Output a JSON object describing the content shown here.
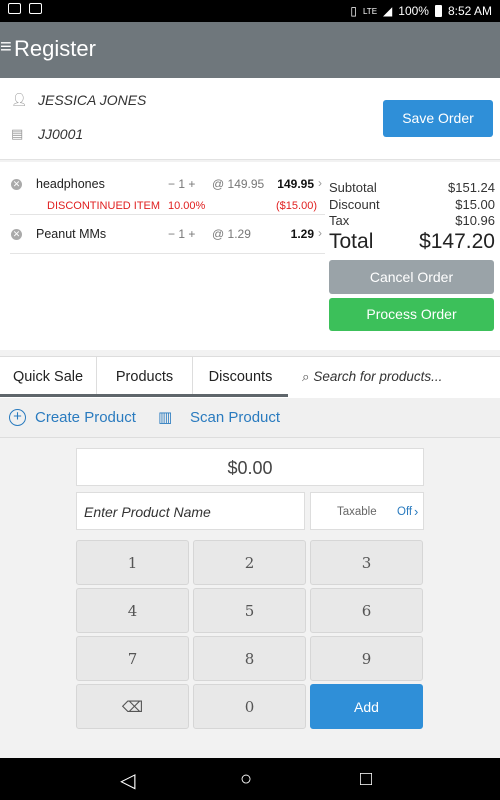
{
  "status_bar": {
    "lte": "LTE",
    "battery": "100%",
    "time": "8:52 AM"
  },
  "app_bar": {
    "menu_icon": "≡",
    "title": "Register"
  },
  "customer": {
    "name": "JESSICA JONES",
    "order_id": "JJ0001",
    "save_label": "Save Order"
  },
  "items": [
    {
      "name": "headphones",
      "qty": "1",
      "unit_price": "@ 149.95",
      "line_total": "149.95",
      "note": "DISCONTINUED ITEM",
      "discount_pct": "10.00%",
      "discount_amt": "($15.00)"
    },
    {
      "name": "Peanut MMs",
      "qty": "1",
      "unit_price": "@ 1.29",
      "line_total": "1.29"
    }
  ],
  "totals": {
    "subtotal_label": "Subtotal",
    "subtotal": "$151.24",
    "discount_label": "Discount",
    "discount": "$15.00",
    "tax_label": "Tax",
    "tax": "$10.96",
    "total_label": "Total",
    "total": "$147.20"
  },
  "actions": {
    "cancel": "Cancel Order",
    "process": "Process Order"
  },
  "tabs": [
    "Quick Sale",
    "Products",
    "Discounts"
  ],
  "search": {
    "placeholder": "Search for products..."
  },
  "product_actions": {
    "create": "Create Product",
    "scan": "Scan Product"
  },
  "quick_sale": {
    "amount": "$0.00",
    "product_name_placeholder": "Enter Product Name",
    "taxable_label": "Taxable",
    "taxable_value": "Off"
  },
  "keypad": [
    "1",
    "2",
    "3",
    "4",
    "5",
    "6",
    "7",
    "8",
    "9",
    "",
    "0",
    "Add"
  ],
  "colors": {
    "app_bar": "#6f777c",
    "primary": "#2f8fd8",
    "success": "#3cc05a",
    "danger": "#e02020",
    "cancel": "#9aa3a8"
  }
}
